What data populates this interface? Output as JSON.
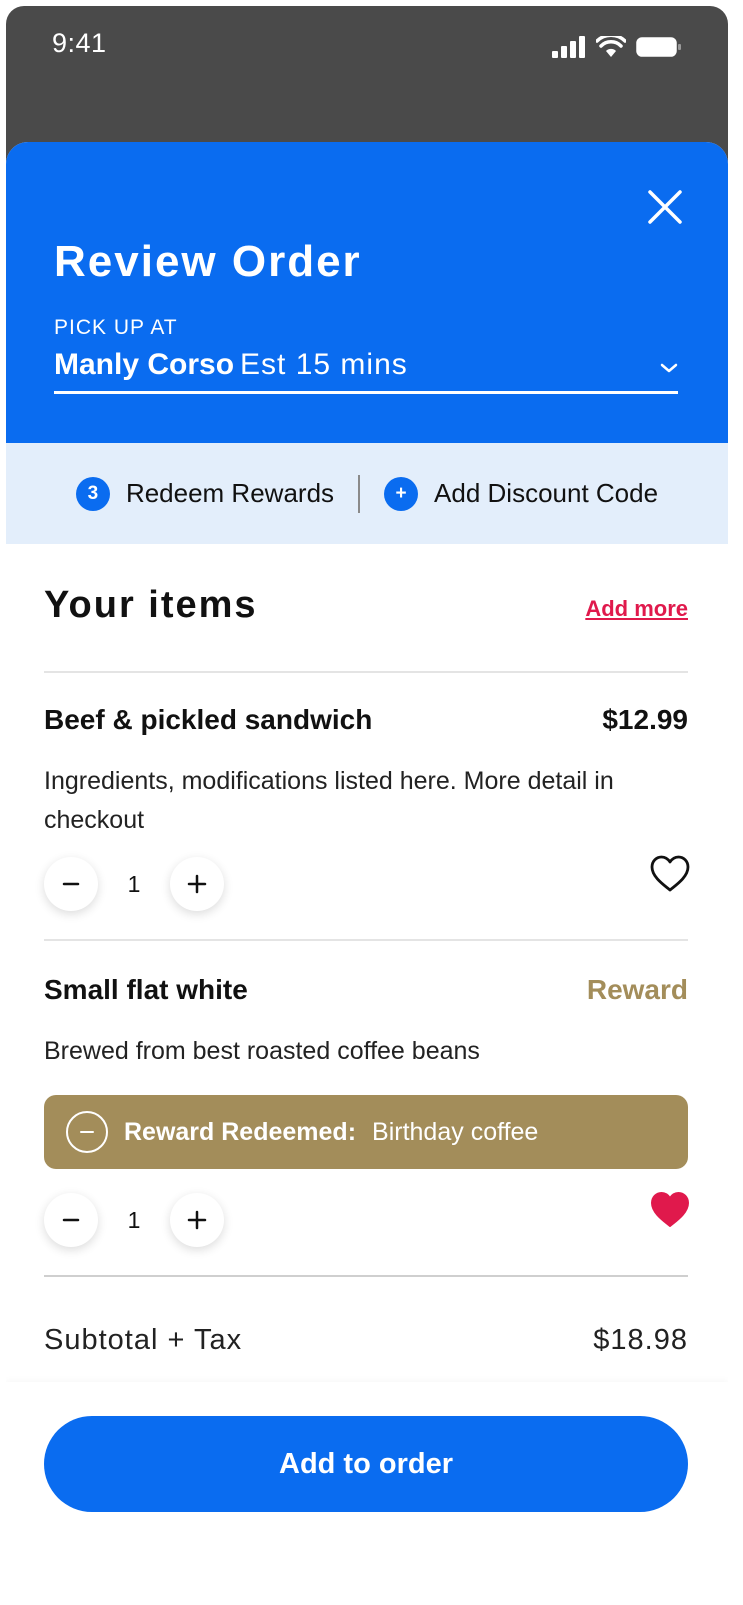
{
  "status_bar": {
    "time": "9:41"
  },
  "header": {
    "title": "Review Order",
    "pickup_label": "PICK UP AT",
    "location_name": "Manly Corso",
    "location_est": "Est 15 mins"
  },
  "rewards_bar": {
    "rewards_count": "3",
    "redeem_label": "Redeem Rewards",
    "discount_icon_glyph": "+",
    "discount_label": "Add Discount Code"
  },
  "items_section": {
    "title": "Your items",
    "add_more": "Add more"
  },
  "items": [
    {
      "name": "Beef & pickled sandwich",
      "price": "$12.99",
      "description": "Ingredients, modifications listed here. More detail in checkout",
      "quantity": "1",
      "favorite": false
    },
    {
      "name": "Small flat white",
      "price": "Reward",
      "description": "Brewed from best roasted coffee beans",
      "reward_redeemed_label": "Reward Redeemed:",
      "reward_redeemed_value": "Birthday coffee",
      "quantity": "1",
      "favorite": true
    }
  ],
  "summary": {
    "subtotal_label": "Subtotal + Tax",
    "subtotal_value": "$18.98"
  },
  "cta": {
    "label": "Add to order"
  },
  "colors": {
    "primary": "#0a6cf0",
    "reward_gold": "#a38d5a",
    "accent_red": "#e0194c",
    "rewards_bar_bg": "#e3eefb"
  }
}
